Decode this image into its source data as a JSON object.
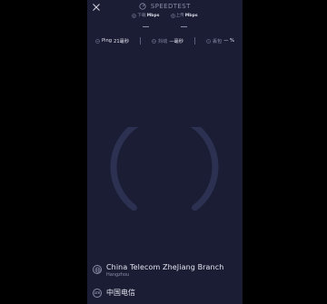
{
  "header": {
    "title": "SPEEDTEST",
    "logo_icon": "speedometer-icon",
    "close_icon": "close-icon"
  },
  "speeds": {
    "download": {
      "label": "下载",
      "unit": "Mbps",
      "value": "—",
      "icon": "download-icon"
    },
    "upload": {
      "label": "上传",
      "unit": "Mbps",
      "value": "—",
      "icon": "upload-icon"
    }
  },
  "metrics": {
    "ping": {
      "label": "Ping",
      "value": "21毫秒",
      "icon": "ping-icon"
    },
    "jitter": {
      "label": "抖动",
      "value": "—毫秒",
      "icon": "jitter-icon"
    },
    "loss": {
      "label": "丢包",
      "value": "— %",
      "icon": "packet-loss-icon"
    }
  },
  "gauge": {
    "color": "#2c3152",
    "progress": 0
  },
  "server": {
    "name": "China Telecom ZheJiang Branch",
    "city": "Hangzhou",
    "icon": "globe-icon"
  },
  "isp": {
    "badge": "LTE",
    "name": "中国电信",
    "icon": "cellular-icon"
  },
  "colors": {
    "background": "#1b1d35",
    "text_primary": "#e4e5ef",
    "text_secondary": "#8b8da8"
  }
}
